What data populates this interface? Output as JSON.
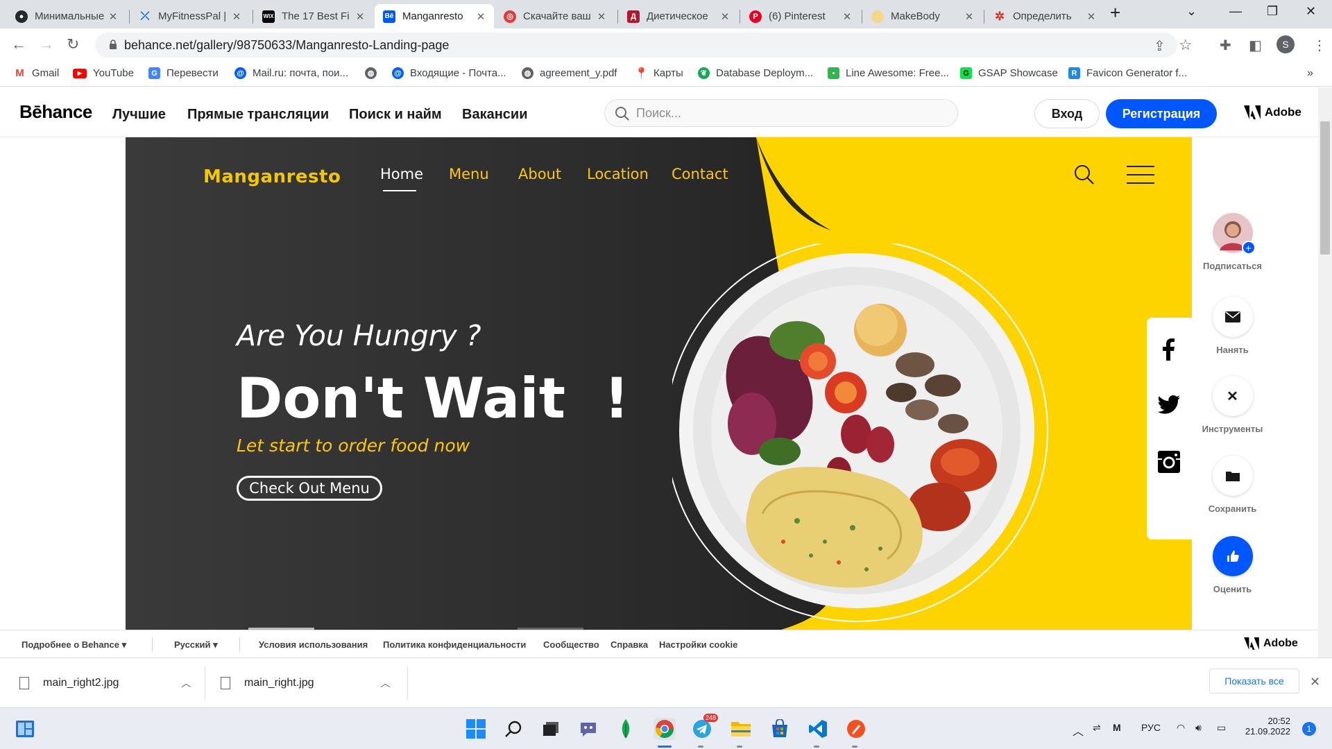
{
  "browser": {
    "tabs": [
      {
        "title": "Минимальные",
        "favicon": "github-icon"
      },
      {
        "title": "MyFitnessPal |",
        "favicon": "myfitnesspal-icon"
      },
      {
        "title": "The 17 Best Fi",
        "favicon": "wix-icon"
      },
      {
        "title": "Manganresto",
        "favicon": "behance-icon"
      },
      {
        "title": "Скачайте ваш",
        "favicon": "red-circle-icon"
      },
      {
        "title": "Диетическое",
        "favicon": "diet-icon"
      },
      {
        "title": "(6) Pinterest",
        "favicon": "pinterest-icon"
      },
      {
        "title": "MakeBody",
        "favicon": "makebody-icon"
      },
      {
        "title": "Определить",
        "favicon": "gear-red-icon"
      }
    ],
    "url": "behance.net/gallery/98750633/Manganresto-Landing-page",
    "profile_initial": "S",
    "bookmarks": [
      {
        "label": "Gmail"
      },
      {
        "label": "YouTube"
      },
      {
        "label": "Перевести"
      },
      {
        "label": "Mail.ru: почта, пои..."
      },
      {
        "label": ""
      },
      {
        "label": "Входящие - Почта..."
      },
      {
        "label": "agreement_y.pdf"
      },
      {
        "label": "Карты"
      },
      {
        "label": "Database Deploym..."
      },
      {
        "label": "Line Awesome: Free..."
      },
      {
        "label": "GSAP Showcase"
      },
      {
        "label": "Favicon Generator f..."
      }
    ]
  },
  "behance": {
    "logo": "Bēhance",
    "nav": [
      "Лучшие",
      "Прямые трансляции",
      "Поиск и найм",
      "Вакансии"
    ],
    "search_placeholder": "Поиск...",
    "login": "Вход",
    "register": "Регистрация",
    "adobe": "Adobe",
    "sidebar": [
      {
        "label": "Подписаться",
        "icon": "avatar-follow-icon"
      },
      {
        "label": "Нанять",
        "icon": "envelope-icon"
      },
      {
        "label": "Инструменты",
        "icon": "tools-icon"
      },
      {
        "label": "Сохранить",
        "icon": "folder-icon"
      },
      {
        "label": "Оценить",
        "icon": "thumbs-up-icon"
      }
    ],
    "footer": {
      "more": "Подробнее о Behance",
      "language": "Русский",
      "links": [
        "Условия использования",
        "Политика конфиденциальности",
        "Сообщество",
        "Справка",
        "Настройки cookie"
      ],
      "adobe": "Adobe"
    }
  },
  "hero": {
    "logo": "Manganresto",
    "nav": [
      "Home",
      "Menu",
      "About",
      "Location",
      "Contact"
    ],
    "headline_small": "Are You Hungry ?",
    "headline_big": "Don't Wait  !",
    "tagline": "Let start to order food now",
    "cta": "Check Out Menu",
    "social": [
      "facebook-icon",
      "twitter-icon",
      "instagram-icon"
    ],
    "colors": {
      "dark": "#2c2c2c",
      "yellow": "#fdd400",
      "accent": "#ffc800"
    }
  },
  "downloads": {
    "files": [
      "main_right2.jpg",
      "main_right.jpg"
    ],
    "show_all": "Показать все"
  },
  "taskbar": {
    "language": "РУС",
    "time": "20:52",
    "date": "21.09.2022",
    "telegram_badge": "248",
    "notifications": "1"
  }
}
